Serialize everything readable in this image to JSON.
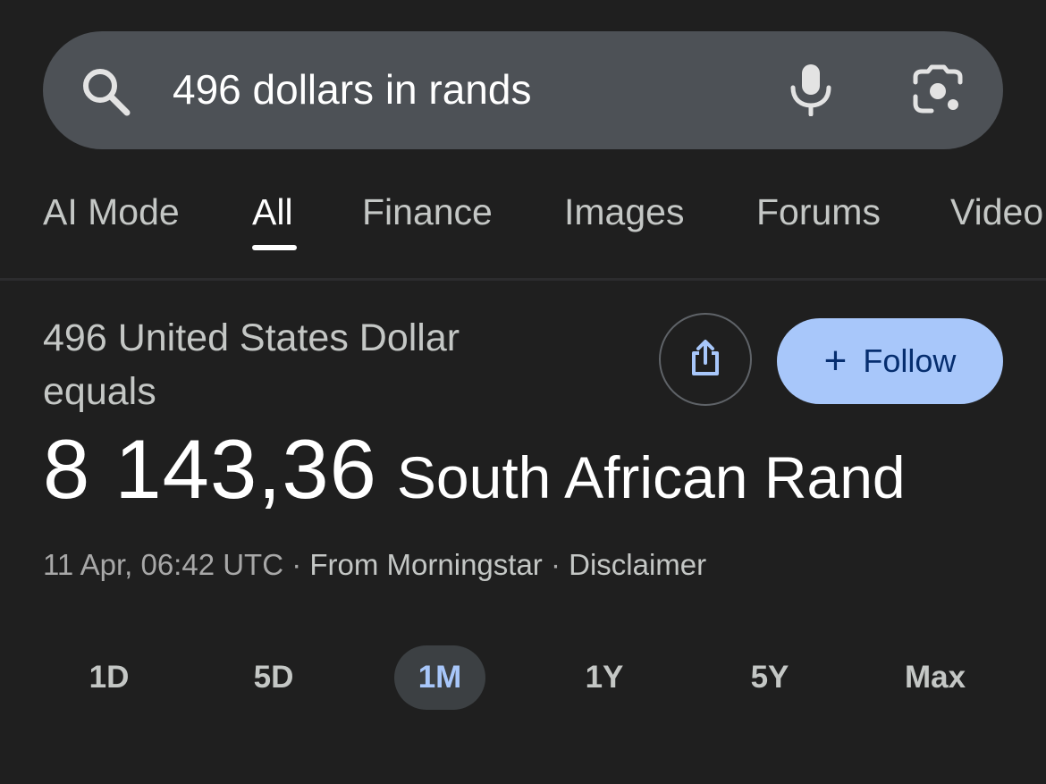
{
  "search": {
    "query": "496 dollars in rands"
  },
  "tabs": [
    {
      "label": "AI Mode"
    },
    {
      "label": "All"
    },
    {
      "label": "Finance"
    },
    {
      "label": "Images"
    },
    {
      "label": "Forums"
    },
    {
      "label": "Video"
    }
  ],
  "active_tab": "All",
  "result": {
    "equals_text": "496 United States Dollar equals",
    "amount": "8 143,36",
    "currency": "South African Rand",
    "timestamp": "11 Apr, 06:42 UTC",
    "separator": "·",
    "source": "From Morningstar",
    "disclaimer": "Disclaimer"
  },
  "actions": {
    "follow_label": "Follow",
    "follow_plus": "+"
  },
  "ranges": [
    {
      "label": "1D"
    },
    {
      "label": "5D"
    },
    {
      "label": "1M"
    },
    {
      "label": "1Y"
    },
    {
      "label": "5Y"
    },
    {
      "label": "Max"
    }
  ],
  "selected_range": "1M",
  "colors": {
    "background": "#1f1f1f",
    "search_bar": "#4d5156",
    "follow_button": "#a8c7fa",
    "selected_range_bg": "#3c4043",
    "selected_range_text": "#a8c7fa"
  },
  "icons": {
    "search": "search-icon",
    "mic": "mic-icon",
    "lens": "lens-icon",
    "share": "share-icon"
  }
}
